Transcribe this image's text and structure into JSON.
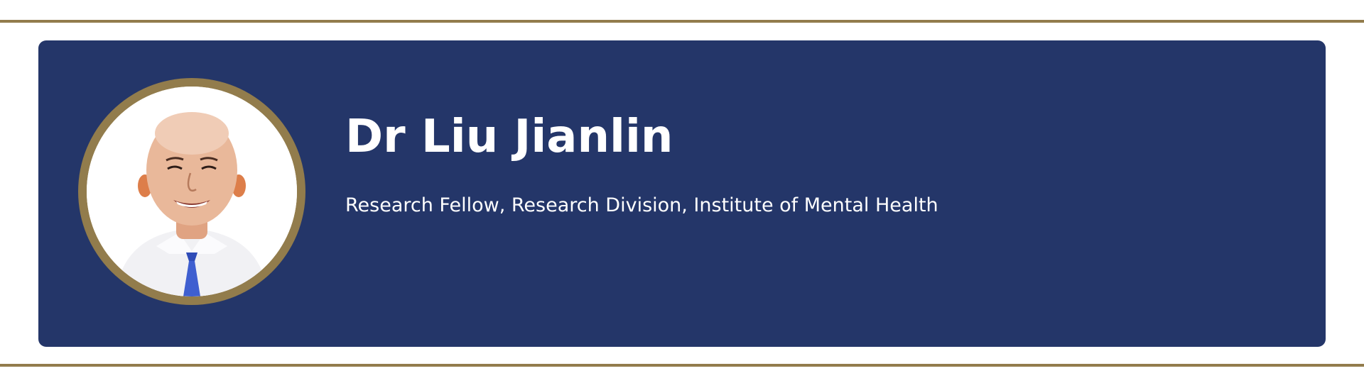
{
  "profile": {
    "name": "Dr Liu Jianlin",
    "role": "Research Fellow, Research Division, Institute of Mental Health",
    "photo_icon": "person-portrait-icon"
  },
  "colors": {
    "accent_gold": "#927c4c",
    "card_navy": "#243669",
    "text": "#ffffff",
    "background": "#ffffff"
  }
}
